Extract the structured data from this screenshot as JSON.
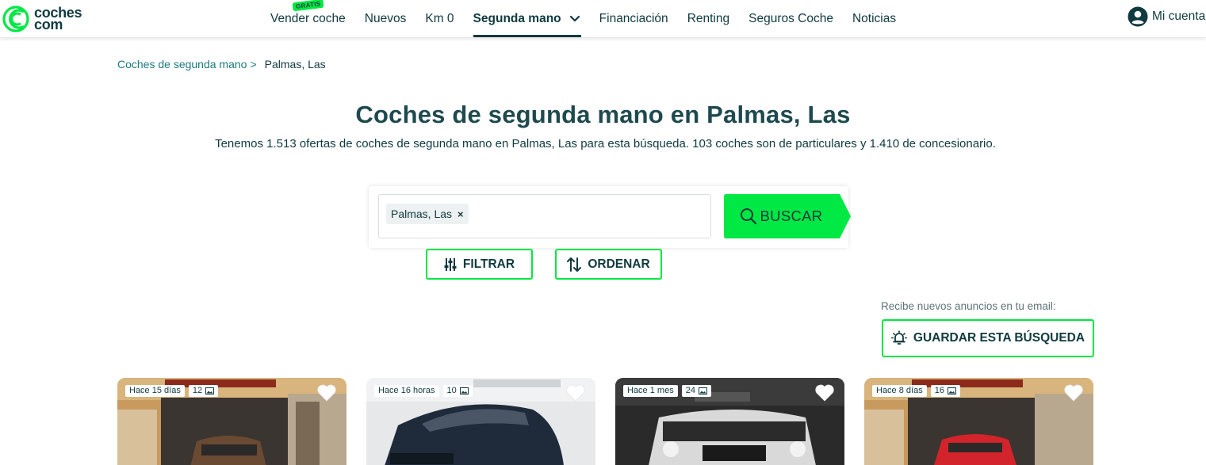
{
  "header": {
    "logo_text_line1": "coches",
    "logo_text_line2": "com",
    "nav": [
      {
        "label": "Vender coche",
        "badge": "GRATIS"
      },
      {
        "label": "Nuevos"
      },
      {
        "label": "Km 0"
      },
      {
        "label": "Segunda mano",
        "active": true
      },
      {
        "label": "Financiación"
      },
      {
        "label": "Renting"
      },
      {
        "label": "Seguros Coche"
      },
      {
        "label": "Noticias"
      }
    ],
    "account_label": "Mi cuenta"
  },
  "breadcrumb": {
    "parent": "Coches de segunda mano",
    "separator": ">",
    "current": "Palmas, Las"
  },
  "title": "Coches de segunda mano en Palmas, Las",
  "subtitle": "Tenemos 1.513 ofertas de coches de segunda mano en Palmas, Las para esta búsqueda. 103 coches son de particulares y 1.410 de concesionario.",
  "search": {
    "chip": "Palmas, Las",
    "chip_remove": "×",
    "button": "BUSCAR"
  },
  "actions": {
    "filter": "FILTRAR",
    "order": "ORDENAR"
  },
  "save_search": {
    "note": "Recibe nuevos anuncios en tu email:",
    "button": "GUARDAR ESTA BÚSQUEDA"
  },
  "cards": [
    {
      "age": "Hace 15 días",
      "photos": "12"
    },
    {
      "age": "Hace 16 horas",
      "photos": "10"
    },
    {
      "age": "Hace 1 mes",
      "photos": "24"
    },
    {
      "age": "Hace 8 días",
      "photos": "16"
    }
  ],
  "colors": {
    "brand_green": "#00e843",
    "brand_dark": "#0f3a3f",
    "link": "#1a7a80"
  },
  "icons": [
    "coches-logo-icon",
    "chevron-down-icon",
    "user-account-icon",
    "close-icon",
    "search-icon",
    "filter-sliders-icon",
    "sort-arrows-icon",
    "bell-icon",
    "photo-icon",
    "heart-icon"
  ]
}
